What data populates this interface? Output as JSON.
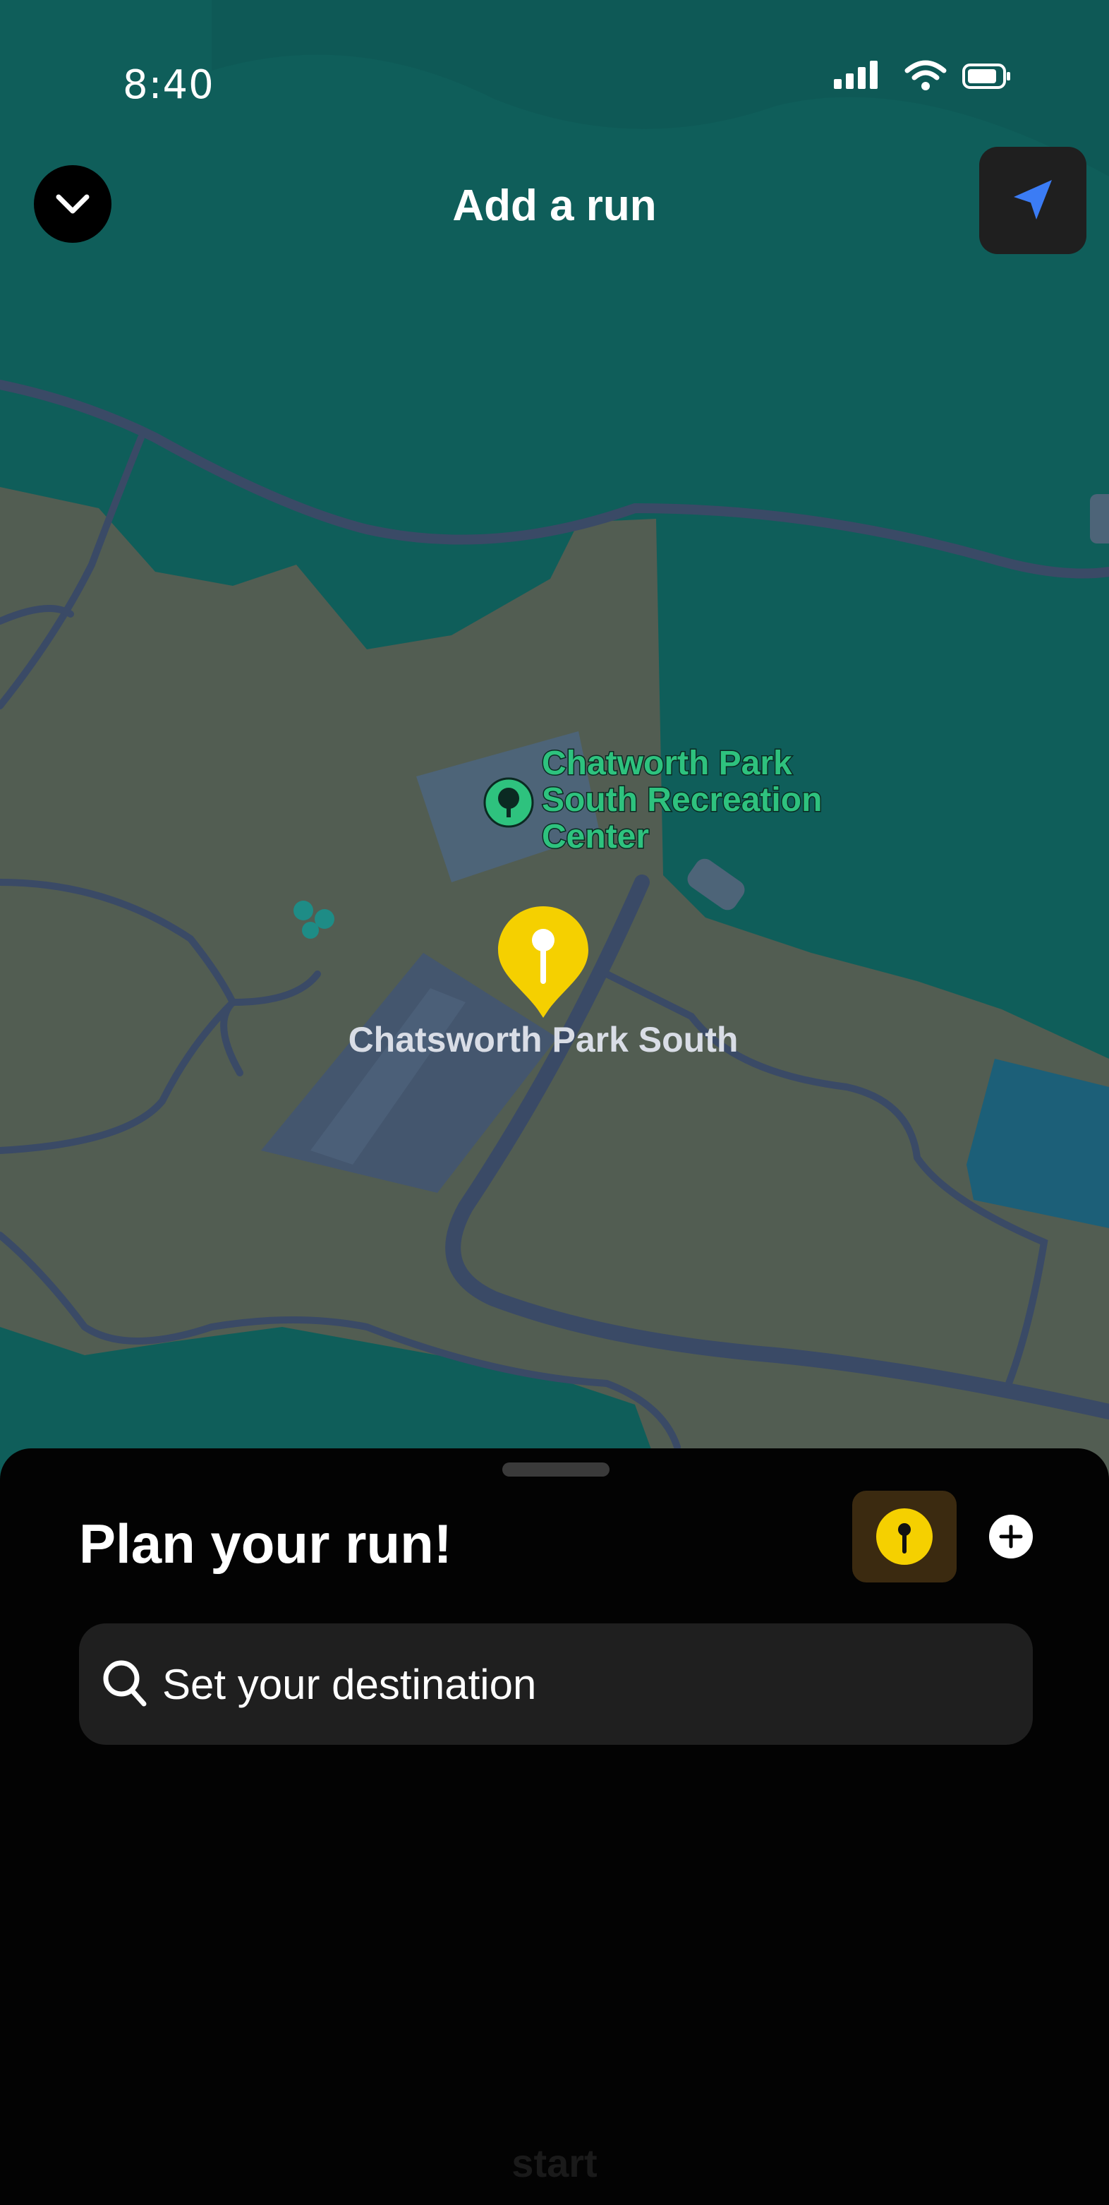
{
  "status_bar": {
    "time": "8:40"
  },
  "header": {
    "title": "Add a run"
  },
  "map": {
    "poi_lines": [
      "Chatworth Park",
      "South Recreation",
      "Center"
    ],
    "pin_label": "Chatsworth Park South"
  },
  "sheet": {
    "title": "Plan your run!",
    "search": {
      "placeholder": "Set your destination"
    },
    "start_label": "start"
  },
  "colors": {
    "map_water": "#0f5e5a",
    "map_land": "#525d52",
    "road": "#3a4a66",
    "pin_yellow": "#f5d000",
    "poi_green": "#2ec27e",
    "locate_blue": "#3b7cf5"
  },
  "icons": [
    "chevron-down-icon",
    "location-arrow-icon",
    "pin-icon",
    "plus-icon",
    "search-icon",
    "tree-icon"
  ]
}
